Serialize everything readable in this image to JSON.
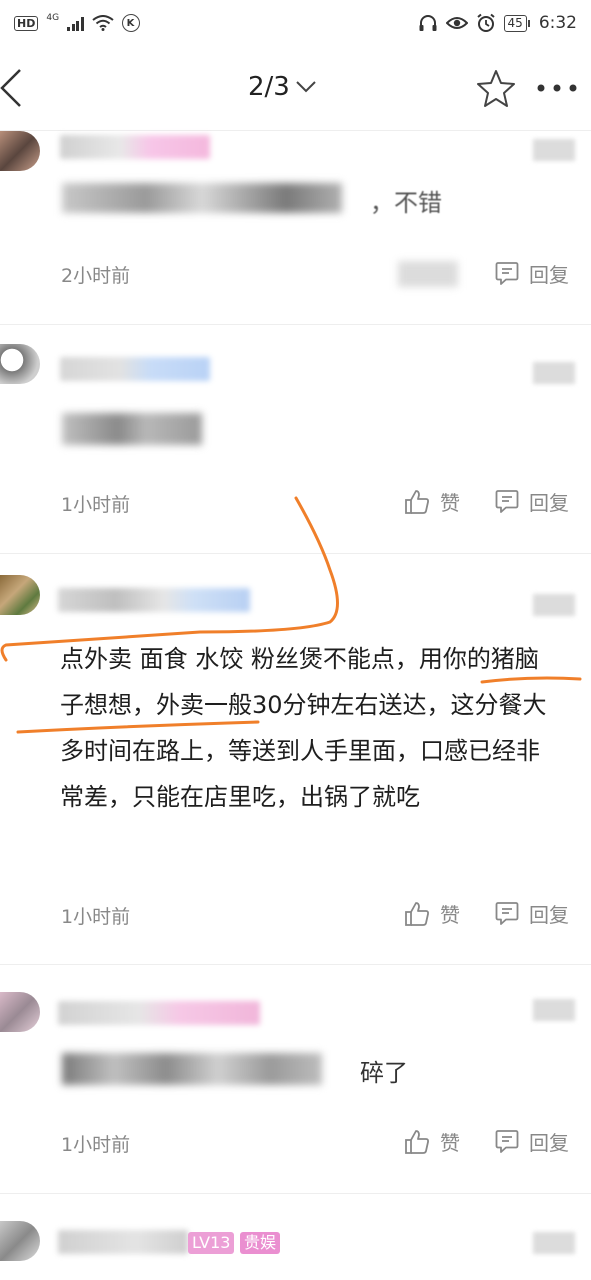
{
  "status_bar": {
    "hd": "HD",
    "network": "4G",
    "k_icon": "K",
    "battery": "45",
    "time": "6:32"
  },
  "header": {
    "page_indicator": "2/3"
  },
  "comments": [
    {
      "time": "2小时前",
      "like_label": "",
      "reply_label": "回复",
      "text_visible": "，不错"
    },
    {
      "time": "1小时前",
      "like_label": "赞",
      "reply_label": "回复"
    },
    {
      "text": "点外卖 面食 水饺 粉丝煲不能点，用你的猪脑子想想，外卖一般30分钟左右送达，这分餐大多时间在路上，等送到人手里面，口感已经非常差，只能在店里吃，出锅了就吃",
      "time": "1小时前",
      "like_label": "赞",
      "reply_label": "回复"
    },
    {
      "text_visible_tail": "碎了",
      "time": "1小时前",
      "like_label": "赞",
      "reply_label": "回复"
    },
    {
      "badges": [
        "LV13",
        "贵娱"
      ]
    }
  ],
  "icons": [
    "back-icon",
    "chevron-down-icon",
    "star-icon",
    "more-icon",
    "thumbs-up-icon",
    "reply-icon",
    "signal-icon",
    "wifi-icon",
    "headphones-icon",
    "eye-icon",
    "alarm-icon",
    "battery-icon"
  ],
  "colors": {
    "annotation_orange": "#f07f2a",
    "muted_text": "#888888",
    "divider": "#eeeeee"
  }
}
